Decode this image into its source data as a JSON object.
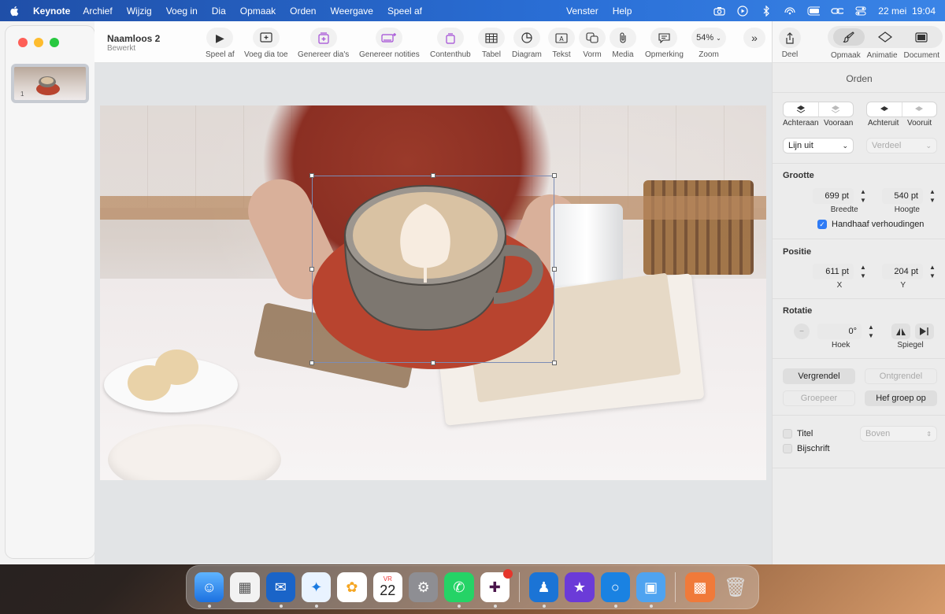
{
  "menubar": {
    "app_name": "Keynote",
    "items": [
      "Archief",
      "Wijzig",
      "Voeg in",
      "Dia",
      "Opmaak",
      "Orden",
      "Weergave",
      "Speel af"
    ],
    "right_items": [
      "Venster",
      "Help"
    ],
    "datetime": "22 mei  19:04"
  },
  "document": {
    "title": "Naamloos 2",
    "subtitle": "Bewerkt"
  },
  "sidebar": {
    "slide_number": "1"
  },
  "toolbar": {
    "play": "Speel af",
    "add_slide": "Voeg dia toe",
    "generate_slides": "Genereer dia's",
    "generate_notes": "Genereer notities",
    "content_hub": "Contenthub",
    "table": "Tabel",
    "chart": "Diagram",
    "text": "Tekst",
    "shape": "Vorm",
    "media": "Media",
    "comment": "Opmerking",
    "zoom_value": "54%",
    "zoom": "Zoom",
    "share": "Deel"
  },
  "inspector": {
    "tabs": [
      "Opmaak",
      "Animatie",
      "Document"
    ],
    "panel_title": "Orden",
    "arrange": {
      "back": "Achteraan",
      "front": "Vooraan",
      "backward": "Achteruit",
      "forward": "Vooruit"
    },
    "align_select": "Lijn uit",
    "distribute_select": "Verdeel",
    "size": {
      "heading": "Grootte",
      "width_value": "699 pt",
      "width_label": "Breedte",
      "height_value": "540 pt",
      "height_label": "Hoogte",
      "keep_ratio": "Handhaaf verhoudingen"
    },
    "position": {
      "heading": "Positie",
      "x_value": "611 pt",
      "x_label": "X",
      "y_value": "204 pt",
      "y_label": "Y"
    },
    "rotation": {
      "heading": "Rotatie",
      "angle_value": "0°",
      "angle_label": "Hoek",
      "flip_label": "Spiegel"
    },
    "buttons": {
      "lock": "Vergrendel",
      "unlock": "Ontgrendel",
      "group": "Groepeer",
      "ungroup": "Hef groep op"
    },
    "title_check": "Titel",
    "title_position": "Boven",
    "caption_check": "Bijschrift"
  },
  "dock": {
    "calendar_month": "VR",
    "calendar_day": "22"
  },
  "colors": {
    "accent": "#2f7bf5",
    "menubar": "#2a6fd6",
    "saucer": "#b8442f",
    "cup": "#7d7770",
    "latte": "#d9c2a3"
  }
}
